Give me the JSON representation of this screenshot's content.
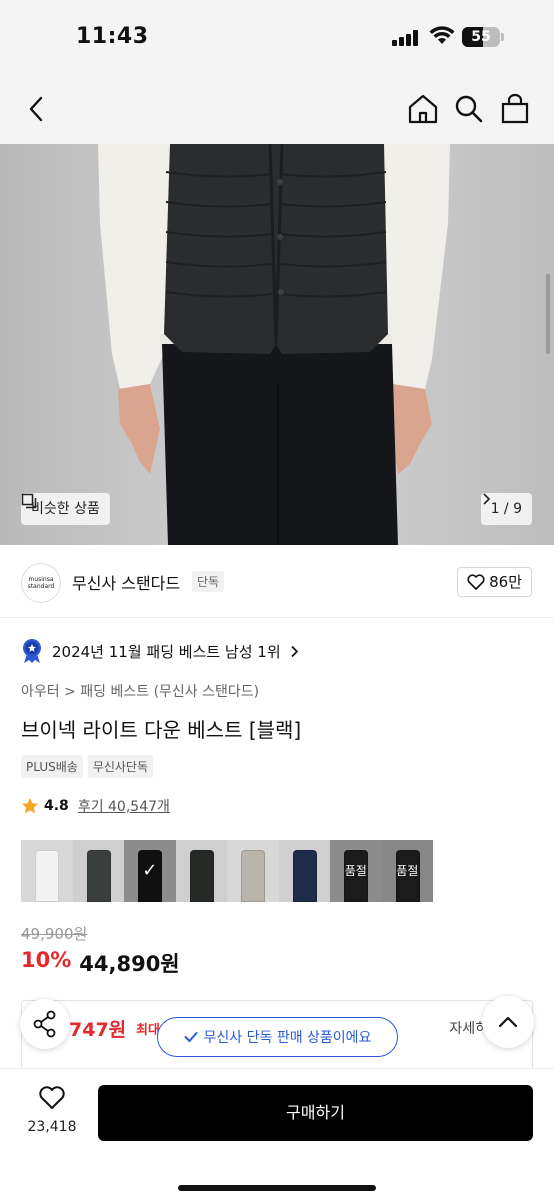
{
  "status": {
    "time": "11:43",
    "battery": "55"
  },
  "hero": {
    "similar_label": "비슷한 상품",
    "counter": "1 / 9"
  },
  "brand": {
    "logo_text": "musinsa standard",
    "name": "무신사 스탠다드",
    "tag": "단독",
    "likes": "86만"
  },
  "ranking": {
    "text": "2024년 11월 패딩 베스트 남성 1위"
  },
  "product": {
    "breadcrumb": "아우터 > 패딩 베스트 (무신사 스탠다드)",
    "title": "브이넥 라이트 다운 베스트 [블랙]",
    "badges": [
      "PLUS배송",
      "무신사단독"
    ],
    "rating": "4.8",
    "reviews": "후기 40,547개"
  },
  "swatches": [
    {
      "color": "#f2f2f0",
      "state": ""
    },
    {
      "color": "#3a3f3d",
      "state": ""
    },
    {
      "color": "#1a1a1a",
      "state": "selected"
    },
    {
      "color": "#262a26",
      "state": ""
    },
    {
      "color": "#b9b5ab",
      "state": ""
    },
    {
      "color": "#1e2b4a",
      "state": ""
    },
    {
      "color": "#2a2a2a",
      "state": "품절"
    },
    {
      "color": "#2a2a2a",
      "state": "품절"
    }
  ],
  "price": {
    "original": "49,900원",
    "discount": "10%",
    "sale": "44,890원"
  },
  "benefit": {
    "amount": "747원",
    "max_label": "최대",
    "detail": "자세히"
  },
  "toast": "무신사 단독 판매 상품이에요",
  "bottom": {
    "wish_count": "23,418",
    "buy_label": "구매하기"
  }
}
